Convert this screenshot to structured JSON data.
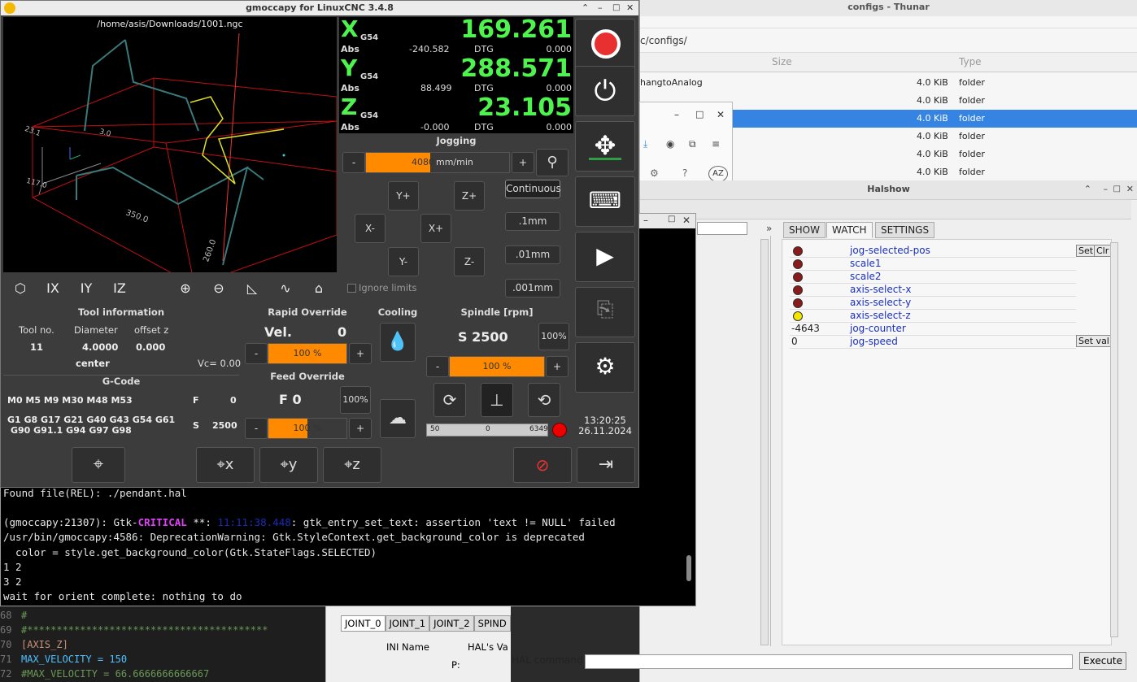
{
  "editor": {
    "lines": [
      {
        "n": "68",
        "text": "#"
      },
      {
        "n": "69",
        "text": "#*****************************************"
      },
      {
        "n": "70",
        "text": "[AXIS_Z]"
      },
      {
        "n": "71",
        "text": "MAX_VELOCITY = 150"
      },
      {
        "n": "72",
        "text": "#MAX_VELOCITY = 66.6666666666667"
      }
    ]
  },
  "joint_tabs": [
    "JOINT_0",
    "JOINT_1",
    "JOINT_2",
    "SPIND"
  ],
  "joint_cols": {
    "ini": "INI Name",
    "hal": "HAL's Va",
    "p": "P:"
  },
  "thunar": {
    "title": "configs - Thunar",
    "path": "c/configs/",
    "col_size": "Size",
    "col_type": "Type",
    "rows": [
      {
        "name": "hangtoAnalog",
        "size": "4.0 KiB",
        "type": "folder"
      },
      {
        "name": "",
        "size": "4.0 KiB",
        "type": "folder"
      },
      {
        "name": "",
        "size": "4.0 KiB",
        "type": "folder"
      },
      {
        "name": "",
        "size": "4.0 KiB",
        "type": "folder"
      },
      {
        "name": "",
        "size": "4.0 KiB",
        "type": "folder"
      },
      {
        "name": "",
        "size": "4.0 KiB",
        "type": "folder"
      }
    ],
    "avatar": "AZ"
  },
  "halshow": {
    "title": "Halshow",
    "tabs": [
      "SHOW",
      "WATCH",
      "SETTINGS"
    ],
    "watch": [
      {
        "name": "jog-selected-pos",
        "value": "",
        "led": "#8b1a1a"
      },
      {
        "name": "scale1",
        "value": "",
        "led": "#8b1a1a"
      },
      {
        "name": "scale2",
        "value": "",
        "led": "#8b1a1a"
      },
      {
        "name": "axis-select-x",
        "value": "",
        "led": "#8b1a1a"
      },
      {
        "name": "axis-select-y",
        "value": "",
        "led": "#8b1a1a"
      },
      {
        "name": "axis-select-z",
        "value": "",
        "led": "#f5e600"
      },
      {
        "name": "jog-counter",
        "value": "-4643",
        "led": ""
      },
      {
        "name": "jog-speed",
        "value": "0",
        "led": ""
      }
    ],
    "set": "Set",
    "clr": "Clr",
    "setval": "Set val",
    "cmd_label": "HAL command :",
    "execute": "Execute",
    "more": "»"
  },
  "terminal": {
    "lines": [
      {
        "a": "Found file(REL): ./pendant.hal",
        "b": "",
        "c": "",
        "d": ""
      },
      {
        "a": "",
        "b": "",
        "c": "",
        "d": ""
      },
      {
        "a": "(gmoccapy:21307): Gtk-",
        "b": "CRITICAL",
        "c": " **: ",
        "t": "11:11:38.448",
        "d": ": gtk_entry_set_text: assertion 'text != NULL' failed"
      },
      {
        "a": "/usr/bin/gmoccapy:4586: DeprecationWarning: Gtk.StyleContext.get_background_color is deprecated",
        "b": "",
        "c": "",
        "d": ""
      },
      {
        "a": "  color = style.get_background_color(Gtk.StateFlags.SELECTED)",
        "b": "",
        "c": "",
        "d": ""
      },
      {
        "a": "1 2",
        "b": "",
        "c": "",
        "d": ""
      },
      {
        "a": "3 2",
        "b": "",
        "c": "",
        "d": ""
      },
      {
        "a": "wait for orient complete: nothing to do",
        "b": "",
        "c": "",
        "d": ""
      }
    ]
  },
  "gm": {
    "title": "gmoccapy for LinuxCNC  3.4.8",
    "file": "/home/asis/Downloads/1001.ngc",
    "axes": [
      {
        "ax": "X",
        "g": "G54",
        "val": "169.261",
        "abs": "-240.582",
        "dtg": "0.000"
      },
      {
        "ax": "Y",
        "g": "G54",
        "val": "288.571",
        "abs": "88.499",
        "dtg": "0.000"
      },
      {
        "ax": "Z",
        "g": "G54",
        "val": "23.105",
        "abs": "-0.000",
        "dtg": "0.000"
      }
    ],
    "abs_label": "Abs",
    "dtg_label": "DTG",
    "jogging": "Jogging",
    "jog_speed": "4080",
    "jog_unit": "mm/min",
    "jog_buttons": {
      "yp": "Y+",
      "zp": "Z+",
      "xm": "X-",
      "xp": "X+",
      "ym": "Y-",
      "zm": "Z-"
    },
    "increments": [
      "Continuous",
      ".1mm",
      ".01mm",
      ".001mm"
    ],
    "ignore_limits": "Ignore limits",
    "tool": {
      "title": "Tool information",
      "h1": "Tool no.",
      "h2": "Diameter",
      "h3": "offset z",
      "no": "11",
      "dia": "4.0000",
      "off": "0.000",
      "pos": "center",
      "vc": "Vc= 0.00"
    },
    "rapid": {
      "title": "Rapid Override",
      "label": "Vel.",
      "val": "0",
      "pct": "100 %"
    },
    "feed": {
      "title": "Feed Override",
      "label": "F  0",
      "pct": "100 %",
      "btn": "100%"
    },
    "cooling": "Cooling",
    "spindle": {
      "title": "Spindle [rpm]",
      "s": "S 2500",
      "btn": "100%",
      "pct": "100 %",
      "min": "50",
      "cur": "0",
      "max": "6349"
    },
    "gcode": {
      "title": "G-Code",
      "m": "M0 M5 M9 M30 M48 M53",
      "f": "F",
      "fval": "0",
      "g1": "G1 G8 G17 G21 G40 G43 G54 G61",
      "g2": "G90 G91.1 G94 G97 G98",
      "s": "S",
      "sval": "2500"
    },
    "time": "13:20:25",
    "date": "26.11.2024",
    "minus": "-",
    "plus": "+",
    "preview_labels": {
      "x": "350.0",
      "y": "260.0",
      "z": "117.0",
      "a": "23.1",
      "b": "3.0"
    }
  }
}
